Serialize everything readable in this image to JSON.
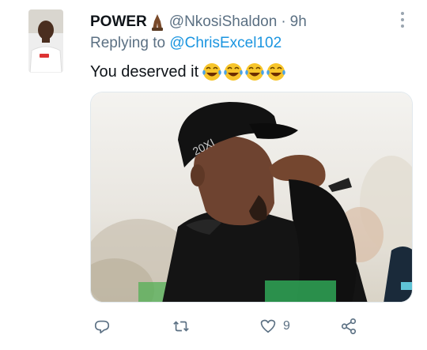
{
  "tweet": {
    "display_name": "POWER",
    "name_emoji": "folded-hands-dark-skin-emoji",
    "handle": "@NkosiShaldon",
    "separator": "·",
    "time": "9h",
    "replying_prefix": "Replying to",
    "replying_to": "@ChrisExcel102",
    "text": "You deserved it",
    "text_emojis": [
      "tears-of-joy-emoji",
      "tears-of-joy-emoji",
      "tears-of-joy-emoji",
      "tears-of-joy-emoji"
    ],
    "media": "photo-golfer-in-black-cap-laughing",
    "actions": {
      "reply_icon": "comment-icon",
      "retweet_icon": "retweet-icon",
      "like_icon": "heart-icon",
      "like_count": "9",
      "share_icon": "share-icon"
    }
  },
  "colors": {
    "primary_text": "#0f1419",
    "secondary_text": "#5b7083",
    "link": "#1b95e0"
  }
}
